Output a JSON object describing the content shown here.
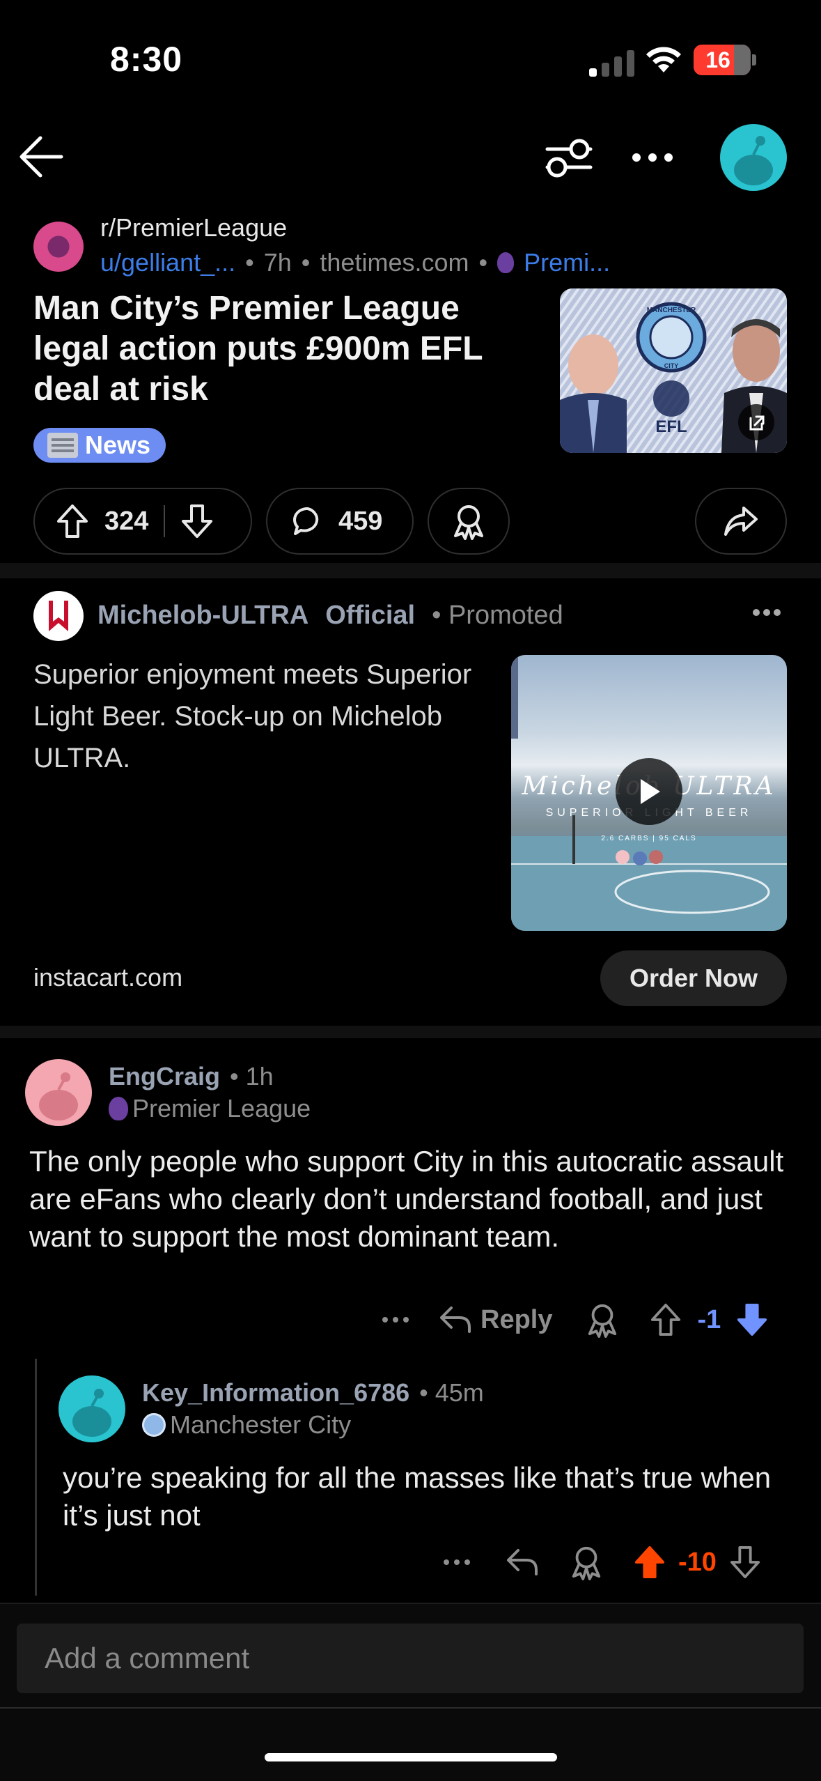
{
  "status_bar": {
    "time": "8:30",
    "battery": "16"
  },
  "post": {
    "subreddit": "r/PremierLeague",
    "username": "u/gelliant_...",
    "age": "7h",
    "domain": "thetimes.com",
    "flair": "Premi...",
    "title": "Man City’s Premier League legal action puts £900m EFL deal at risk",
    "tag": "News",
    "upvotes": "324",
    "comments": "459",
    "thumbnail_labels": [
      "MANCHESTER",
      "CITY",
      "EFL"
    ]
  },
  "ad": {
    "advertiser": "Michelob-ULTRA",
    "official": "Official",
    "promoted": "Promoted",
    "body": "Superior enjoyment meets Superior Light Beer. Stock-up on Michelob ULTRA.",
    "video_brand": "Michelob ULTRA",
    "video_tagline": "SUPERIOR LIGHT BEER",
    "video_small": "2.6 CARBS | 95 CALS",
    "domain": "instacart.com",
    "cta": "Order Now"
  },
  "comments": [
    {
      "user": "EngCraig",
      "age": "1h",
      "flair": "Premier League",
      "body": "The only people who support City in this autocratic assault are eFans who clearly don’t understand football, and just want to support the most dominant team.",
      "reply_label": "Reply",
      "score": "-1",
      "vote_state": "downvoted",
      "score_color": "#7193ff"
    },
    {
      "user": "Key_Information_6786",
      "age": "45m",
      "flair": "Manchester City",
      "body": "you’re speaking for all the masses like that’s true when it’s just not",
      "score": "-10",
      "vote_state": "upvoted",
      "score_color": "#ff4500"
    }
  ],
  "composer": {
    "placeholder": "Add a comment"
  }
}
